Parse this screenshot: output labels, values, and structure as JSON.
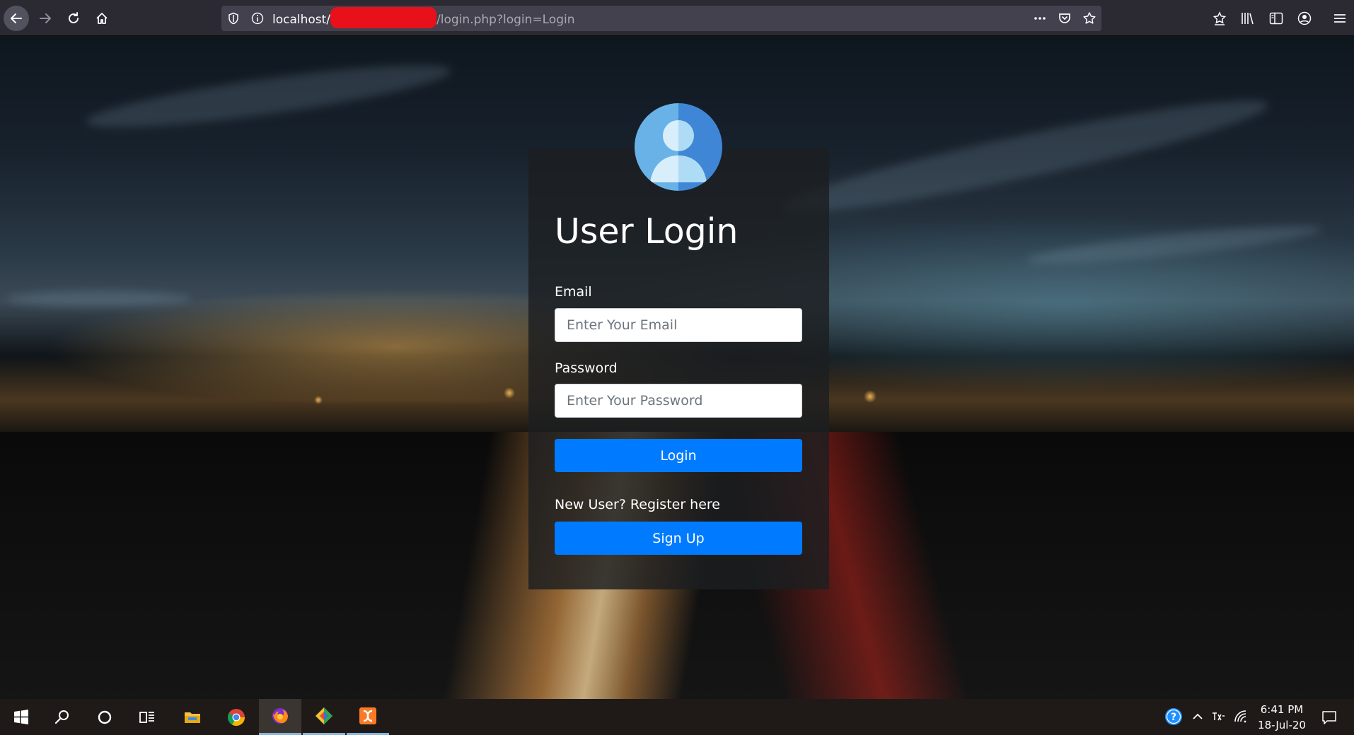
{
  "browser": {
    "url_host": "localhost/",
    "url_path": "/login.php?login=Login"
  },
  "login_form": {
    "title": "User Login",
    "email_label": "Email",
    "email_placeholder": "Enter Your Email",
    "password_label": "Password",
    "password_placeholder": "Enter Your Password",
    "login_button": "Login",
    "register_prompt": "New User? Register here",
    "signup_button": "Sign Up"
  },
  "taskbar": {
    "time": "6:41 PM",
    "date": "18-Jul-20"
  },
  "colors": {
    "primary_button": "#007bff",
    "card_background": "#1c1e21",
    "avatar_light": "#aedcf5",
    "avatar_dark": "#3f87d6"
  }
}
